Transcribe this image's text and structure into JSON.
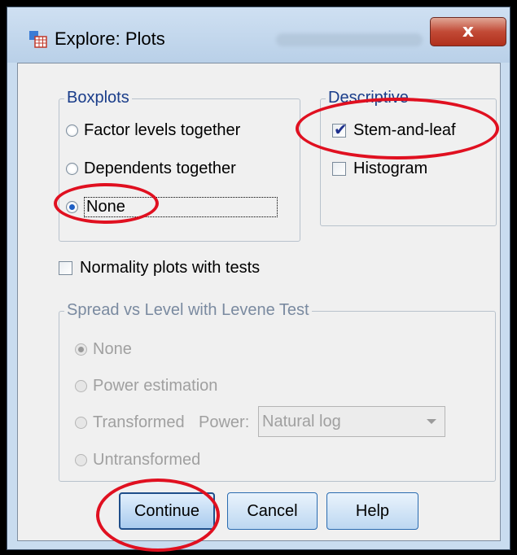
{
  "window": {
    "title": "Explore: Plots",
    "close_label": "x"
  },
  "boxplots": {
    "legend": "Boxplots",
    "options": [
      {
        "label": "Factor levels together",
        "selected": false
      },
      {
        "label": "Dependents together",
        "selected": false
      },
      {
        "label": "None",
        "selected": true
      }
    ]
  },
  "descriptive": {
    "legend": "Descriptive",
    "options": [
      {
        "label": "Stem-and-leaf",
        "checked": true
      },
      {
        "label": "Histogram",
        "checked": false
      }
    ]
  },
  "normality": {
    "label": "Normality plots with tests",
    "checked": false
  },
  "spread": {
    "legend": "Spread vs Level with Levene Test",
    "enabled": false,
    "options": [
      {
        "label": "None",
        "selected": true
      },
      {
        "label": "Power estimation",
        "selected": false
      },
      {
        "label": "Transformed",
        "selected": false
      },
      {
        "label": "Untransformed",
        "selected": false
      }
    ],
    "power_label": "Power:",
    "power_value": "Natural log"
  },
  "buttons": {
    "continue": "Continue",
    "cancel": "Cancel",
    "help": "Help"
  },
  "annotation_color": "#e01020"
}
